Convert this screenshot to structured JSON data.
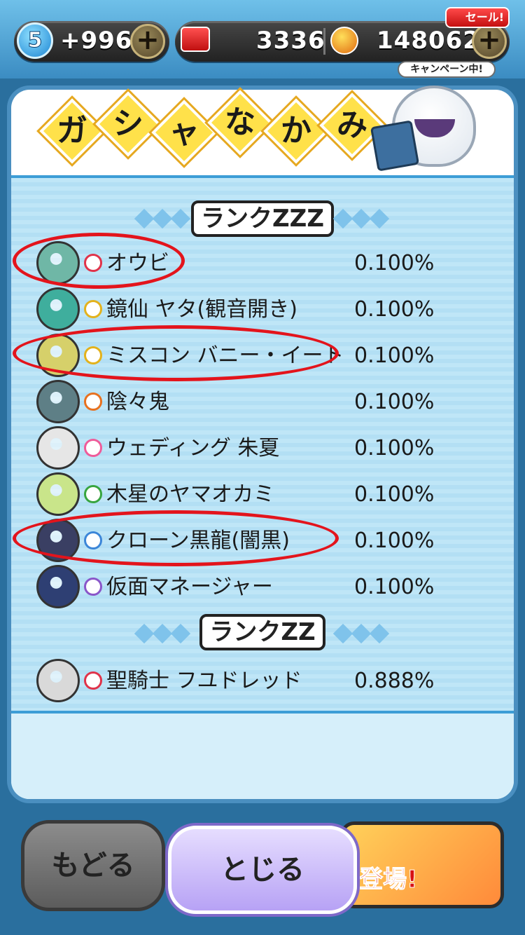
{
  "top_bar": {
    "level": "5",
    "stamina": "+996",
    "currency_y": "3336",
    "currency_coins": "148062",
    "sale_badge": "セール!",
    "campaign_badge": "キャンペーン中!"
  },
  "dialog": {
    "title_chars": [
      "ガ",
      "シ",
      "ャ",
      "な",
      "か",
      "み"
    ],
    "rank_zzz": "ランクZZZ",
    "rank_zz": "ランクZZ",
    "rows_zzz": [
      {
        "name": "オウビ",
        "pct": "0.100%",
        "tribe": "red",
        "circled": true
      },
      {
        "name": "鏡仙 ヤタ(観音開き)",
        "pct": "0.100%",
        "tribe": "yellow",
        "circled": false
      },
      {
        "name": "ミスコン バニー・イート",
        "pct": "0.100%",
        "tribe": "yellow",
        "circled": true
      },
      {
        "name": "陰々鬼",
        "pct": "0.100%",
        "tribe": "orange",
        "circled": false
      },
      {
        "name": "ウェディング 朱夏",
        "pct": "0.100%",
        "tribe": "pink",
        "circled": false
      },
      {
        "name": "木星のヤマオカミ",
        "pct": "0.100%",
        "tribe": "green",
        "circled": false
      },
      {
        "name": "クローン黒龍(闇黒)",
        "pct": "0.100%",
        "tribe": "blue",
        "circled": true
      },
      {
        "name": "仮面マネージャー",
        "pct": "0.100%",
        "tribe": "purple",
        "circled": false
      }
    ],
    "rows_zz": [
      {
        "name": "聖騎士 フユドレッド",
        "pct": "0.888%",
        "tribe": "red",
        "circled": false
      }
    ]
  },
  "buttons": {
    "back": "もどる",
    "close": "とじる",
    "banner": "登場!"
  },
  "colors": {
    "red": "#e0334a",
    "yellow": "#e3b21c",
    "orange": "#e8711f",
    "pink": "#ef5c9a",
    "green": "#38a53f",
    "blue": "#3c86d8",
    "purple": "#8a56c9"
  }
}
